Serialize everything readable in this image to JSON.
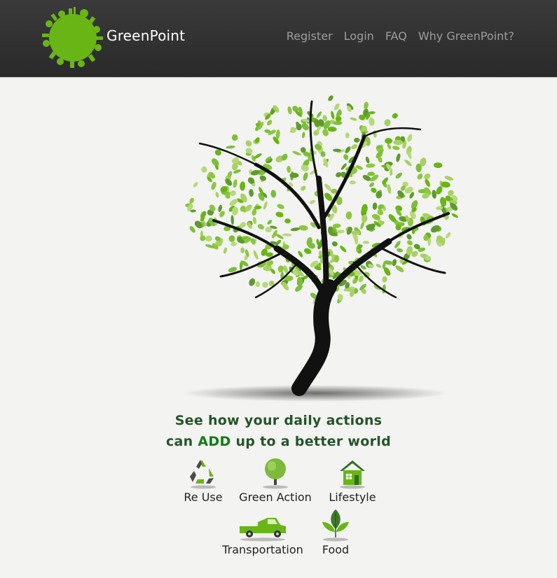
{
  "navbar": {
    "brand": "GreenPoint",
    "links": [
      "Register",
      "Login",
      "FAQ",
      "Why GreenPoint?"
    ]
  },
  "hero": {
    "tagline_line1": "See how your daily actions",
    "tagline_line2_pre": "can ",
    "tagline_highlight": "ADD",
    "tagline_line2_post": " up to a better world"
  },
  "categories": [
    {
      "label": "Re Use",
      "icon": "recycle-icon"
    },
    {
      "label": "Green Action",
      "icon": "tree-icon"
    },
    {
      "label": "Lifestyle",
      "icon": "house-icon"
    },
    {
      "label": "Transportation",
      "icon": "pickup-truck-icon"
    },
    {
      "label": "Food",
      "icon": "leaf-sprout-icon"
    }
  ],
  "colors": {
    "navbar": "#2e2e2e",
    "brand_green": "#6ab516",
    "tagline": "#24542a",
    "highlight": "#0d7d14",
    "nav_link": "#9d9d9d"
  }
}
